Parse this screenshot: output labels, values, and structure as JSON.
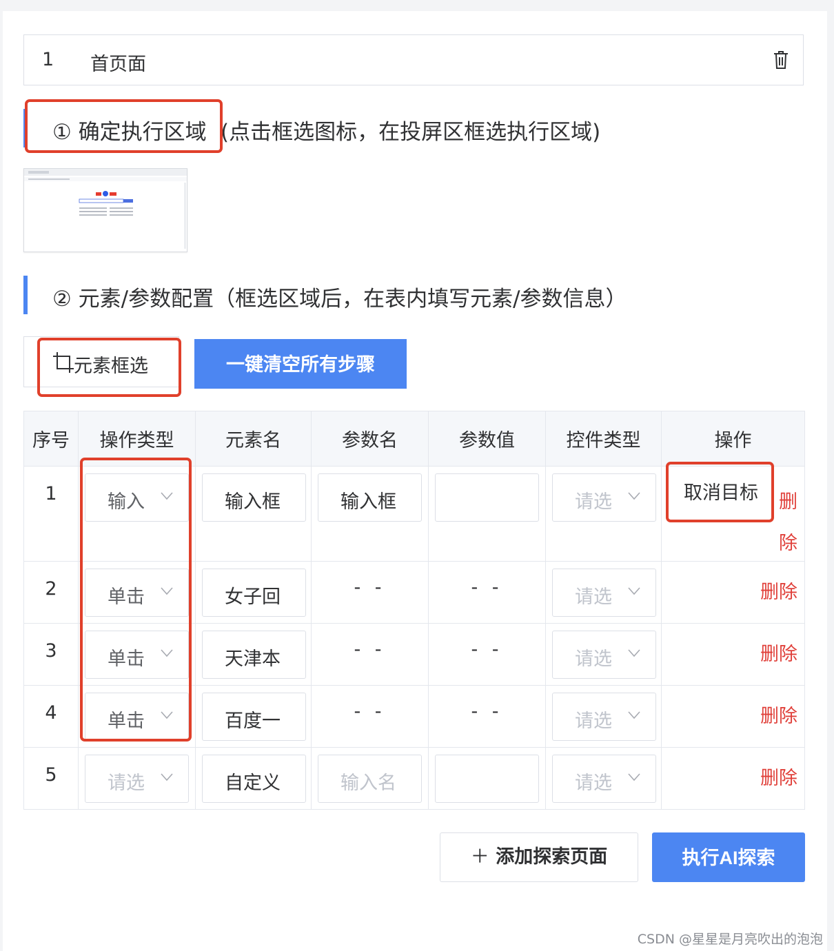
{
  "page": {
    "index": "1",
    "name": "首页面"
  },
  "section1": {
    "marker": "①",
    "title": "确定执行区域",
    "hint": "(点击框选图标，在投屏区框选执行区域)"
  },
  "section2": {
    "marker": "②",
    "title": "元素/参数配置（框选区域后，在表内填写元素/参数信息）"
  },
  "toolbar": {
    "select_elements": "元素框选",
    "clear_steps": "一键清空所有步骤"
  },
  "table": {
    "headers": [
      "序号",
      "操作类型",
      "元素名",
      "参数名",
      "参数值",
      "控件类型",
      "操作"
    ],
    "rows": [
      {
        "no": "1",
        "op": "输入",
        "element": "输入框",
        "param": "输入框",
        "value": "",
        "ctrl": "请选",
        "cancel": "取消目标",
        "del": "删除"
      },
      {
        "no": "2",
        "op": "单击",
        "element": "女子回",
        "param": "- -",
        "value": "- -",
        "ctrl": "请选",
        "del": "删除"
      },
      {
        "no": "3",
        "op": "单击",
        "element": "天津本",
        "param": "- -",
        "value": "- -",
        "ctrl": "请选",
        "del": "删除"
      },
      {
        "no": "4",
        "op": "单击",
        "element": "百度一",
        "param": "- -",
        "value": "- -",
        "ctrl": "请选",
        "del": "删除"
      },
      {
        "no": "5",
        "op": "请选",
        "element": "自定义",
        "param": "输入名",
        "value": "",
        "ctrl": "请选",
        "del": "删除"
      }
    ]
  },
  "footer": {
    "add_page": "添加探索页面",
    "add_icon": "plus-icon",
    "run": "执行AI探索"
  },
  "watermark": "CSDN @星星是月亮吹出的泡泡",
  "colors": {
    "primary": "#4c86f2",
    "danger": "#e0403a",
    "highlight": "#e0402b"
  }
}
